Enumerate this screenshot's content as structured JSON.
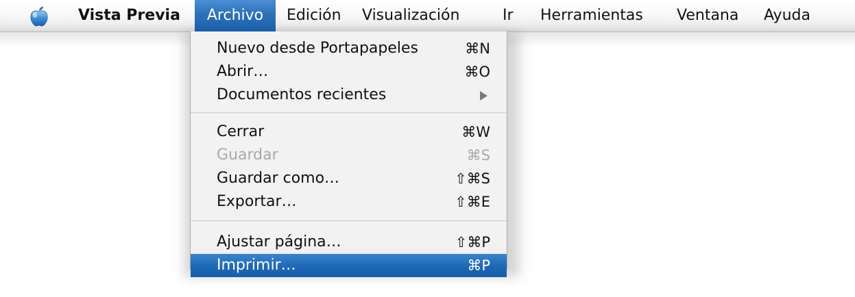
{
  "menubar": {
    "apple_icon": "apple-logo-icon",
    "app_name": "Vista Previa",
    "menus": {
      "archivo": "Archivo",
      "edicion": "Edición",
      "visualizacion": "Visualización",
      "ir": "Ir",
      "herramientas": "Herramientas",
      "ventana": "Ventana",
      "ayuda": "Ayuda"
    },
    "active_menu": "Archivo",
    "accent_color": "#1f68b5"
  },
  "archivo_menu": {
    "items": [
      {
        "label": "Nuevo desde Portapapeles",
        "shortcut": "⌘N",
        "enabled": true
      },
      {
        "label": "Abrir…",
        "shortcut": "⌘O",
        "enabled": true
      },
      {
        "label": "Documentos recientes",
        "submenu": true,
        "enabled": true
      },
      {
        "label": "Cerrar",
        "shortcut": "⌘W",
        "enabled": true
      },
      {
        "label": "Guardar",
        "shortcut": "⌘S",
        "enabled": false
      },
      {
        "label": "Guardar como…",
        "shortcut": "⇧⌘S",
        "enabled": true
      },
      {
        "label": "Exportar…",
        "shortcut": "⇧⌘E",
        "enabled": true
      },
      {
        "label": "Ajustar página…",
        "shortcut": "⇧⌘P",
        "enabled": true
      },
      {
        "label": "Imprimir…",
        "shortcut": "⌘P",
        "enabled": true,
        "highlighted": true
      }
    ]
  }
}
